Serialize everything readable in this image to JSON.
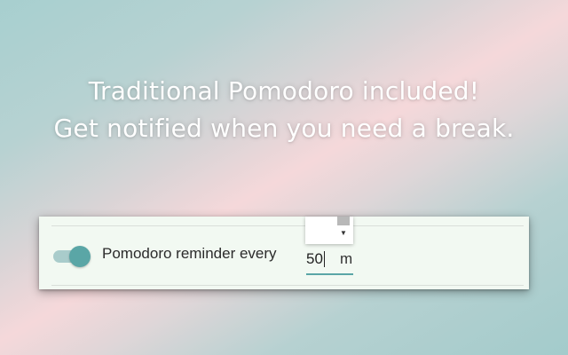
{
  "headline": {
    "line1": "Traditional Pomodoro included!",
    "line2": "Get notified when you need a break."
  },
  "settings": {
    "pomodoro_toggle": {
      "state": "on"
    },
    "pomodoro_label": "Pomodoro reminder every",
    "interval_value": "50",
    "interval_unit": "m"
  },
  "icons": {
    "toggle": "toggle-switch-icon",
    "spinner_down": "caret-down-icon"
  },
  "colors": {
    "accent": "#5aa6a6",
    "accent_light": "#a9cccb",
    "panel_bg": "#f2f9f2"
  }
}
